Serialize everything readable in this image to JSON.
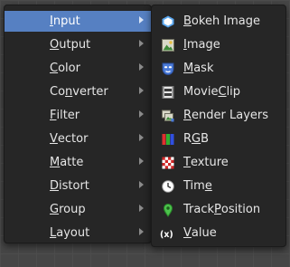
{
  "main_menu": {
    "items": [
      {
        "pre": "",
        "u": "I",
        "post": "nput"
      },
      {
        "pre": "",
        "u": "O",
        "post": "utput"
      },
      {
        "pre": "",
        "u": "C",
        "post": "olor"
      },
      {
        "pre": "Co",
        "u": "n",
        "post": "verter"
      },
      {
        "pre": "",
        "u": "F",
        "post": "ilter"
      },
      {
        "pre": "",
        "u": "V",
        "post": "ector"
      },
      {
        "pre": "",
        "u": "M",
        "post": "atte"
      },
      {
        "pre": "",
        "u": "D",
        "post": "istort"
      },
      {
        "pre": "",
        "u": "G",
        "post": "roup"
      },
      {
        "pre": "",
        "u": "L",
        "post": "ayout"
      }
    ],
    "active_index": 0
  },
  "input_submenu": {
    "items": [
      {
        "pre": "",
        "u": "B",
        "post": "okeh Image",
        "icon": "bokeh-image-icon"
      },
      {
        "pre": "",
        "u": "I",
        "post": "mage",
        "icon": "image-icon"
      },
      {
        "pre": "",
        "u": "M",
        "post": "ask",
        "icon": "mask-icon"
      },
      {
        "pre": "Movie ",
        "u": "C",
        "post": "lip",
        "icon": "movie-clip-icon"
      },
      {
        "pre": "",
        "u": "R",
        "post": "ender Layers",
        "icon": "render-layers-icon"
      },
      {
        "pre": "R",
        "u": "G",
        "post": "B",
        "icon": "rgb-icon"
      },
      {
        "pre": "",
        "u": "T",
        "post": "exture",
        "icon": "texture-icon"
      },
      {
        "pre": "Tim",
        "u": "e",
        "post": "",
        "icon": "time-icon"
      },
      {
        "pre": "Track ",
        "u": "P",
        "post": "osition",
        "icon": "track-position-icon"
      },
      {
        "pre": "",
        "u": "V",
        "post": "alue",
        "icon": "value-icon"
      }
    ]
  },
  "colors": {
    "menu_bg": "#262626",
    "highlight": "#5680c2",
    "text": "#e6e6e6"
  }
}
